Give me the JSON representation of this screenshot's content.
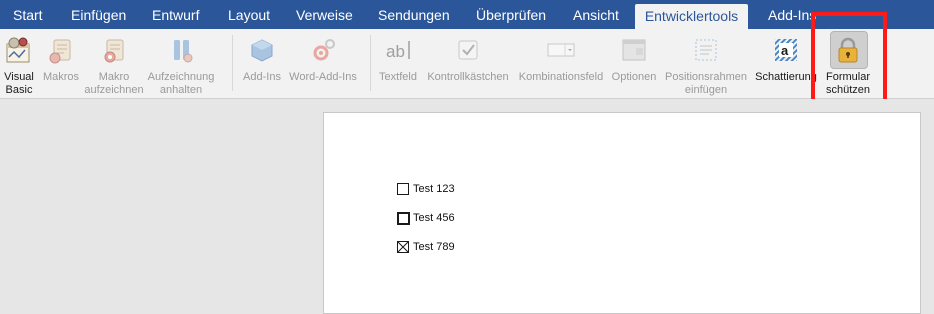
{
  "tabs": [
    {
      "label": "Start"
    },
    {
      "label": "Einfügen"
    },
    {
      "label": "Entwurf"
    },
    {
      "label": "Layout"
    },
    {
      "label": "Verweise"
    },
    {
      "label": "Sendungen"
    },
    {
      "label": "Überprüfen"
    },
    {
      "label": "Ansicht"
    },
    {
      "label": "Entwicklertools",
      "active": true
    },
    {
      "label": "Add-Ins"
    }
  ],
  "ribbon": {
    "buttons": [
      {
        "label": "Visual\nBasic",
        "icon": "visual-basic-icon",
        "enabled": true
      },
      {
        "label": "Makros",
        "icon": "macros-icon",
        "enabled": false
      },
      {
        "label": "Makro\naufzeichnen",
        "icon": "record-macro-icon",
        "enabled": false
      },
      {
        "label": "Aufzeichnung\nanhalten",
        "icon": "pause-recording-icon",
        "enabled": false
      },
      {
        "label": "Add-Ins",
        "icon": "add-ins-icon",
        "enabled": false
      },
      {
        "label": "Word-Add-Ins",
        "icon": "word-add-ins-icon",
        "enabled": false
      },
      {
        "label": "Textfeld",
        "icon": "text-field-icon",
        "enabled": false
      },
      {
        "label": "Kontrollkästchen",
        "icon": "checkbox-control-icon",
        "enabled": false
      },
      {
        "label": "Kombinationsfeld",
        "icon": "combo-box-icon",
        "enabled": false
      },
      {
        "label": "Optionen",
        "icon": "options-icon",
        "enabled": false
      },
      {
        "label": "Positionsrahmen\neinfügen",
        "icon": "insert-frame-icon",
        "enabled": false
      },
      {
        "label": "Schattierung",
        "icon": "shading-icon",
        "enabled": true
      },
      {
        "label": "Formular\nschützen",
        "icon": "lock-icon",
        "enabled": true,
        "selected": true
      }
    ]
  },
  "document": {
    "checkboxes": [
      {
        "label": "Test 123",
        "state": "unchecked"
      },
      {
        "label": "Test 456",
        "state": "unchecked-bold"
      },
      {
        "label": "Test 789",
        "state": "checked"
      }
    ]
  },
  "colors": {
    "tab_bar": "#2b579a",
    "ribbon_bg": "#f2f2f2",
    "highlight": "#ff1a1a",
    "lock_gold": "#e8b33a"
  }
}
